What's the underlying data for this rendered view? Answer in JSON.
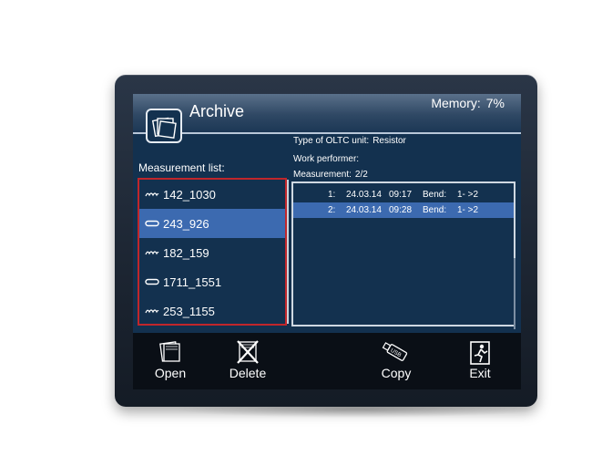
{
  "header": {
    "title": "Archive",
    "memory_label": "Memory:",
    "memory_value": "7%"
  },
  "info": {
    "oltc_label": "Type of OLTC unit:",
    "oltc_value": "Resistor",
    "performer_label": "Work performer:",
    "measurement_label": "Measurement:",
    "measurement_value": "2/2"
  },
  "measurement_list": {
    "label": "Measurement list:",
    "items": [
      {
        "name": "142_1030",
        "icon": "wave-icon",
        "selected": false
      },
      {
        "name": "243_926",
        "icon": "pill-icon",
        "selected": true
      },
      {
        "name": "182_159",
        "icon": "wave-icon",
        "selected": false
      },
      {
        "name": "1711_1551",
        "icon": "pill-icon",
        "selected": false
      },
      {
        "name": "253_1155",
        "icon": "wave-icon",
        "selected": false
      }
    ]
  },
  "measurements": [
    {
      "index": "1:",
      "date": "24.03.14",
      "time": "09:17",
      "bend_label": "Bend:",
      "bend": "1- >2",
      "selected": false
    },
    {
      "index": "2:",
      "date": "24.03.14",
      "time": "09:28",
      "bend_label": "Bend:",
      "bend": "1- >2",
      "selected": true
    }
  ],
  "toolbar": {
    "open_label": "Open",
    "delete_label": "Delete",
    "copy_label": "Copy",
    "exit_label": "Exit",
    "copy_icon_text": "USB"
  },
  "colors": {
    "screen_bg": "#13314f",
    "selection": "#3c6ab0",
    "list_border": "#c0262b",
    "toolbar_bg": "#0a0f16"
  }
}
